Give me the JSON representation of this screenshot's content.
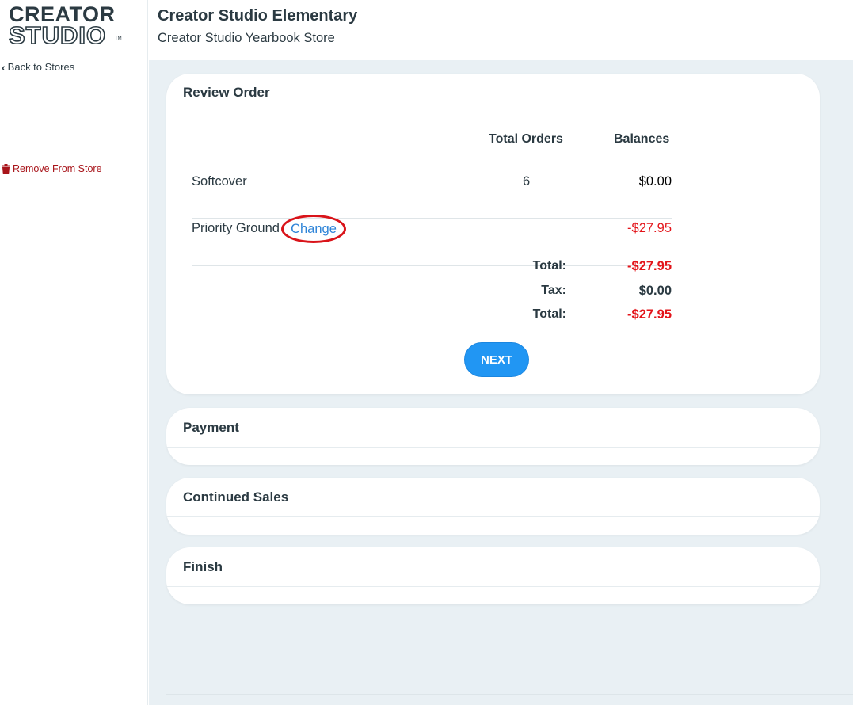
{
  "sidebar": {
    "logo": {
      "line1": "CREATOR",
      "line2": "STUDIO",
      "tm": "TM"
    },
    "back_label": "Back to Stores",
    "remove_label": "Remove From Store"
  },
  "header": {
    "title": "Creator Studio Elementary",
    "subtitle": "Creator Studio Yearbook Store"
  },
  "review": {
    "title": "Review Order",
    "columns": {
      "orders": "Total Orders",
      "balances": "Balances"
    },
    "items": [
      {
        "name": "Softcover",
        "orders": "6",
        "balance": "$0.00"
      },
      {
        "name": "Priority Ground",
        "action": "Change",
        "balance": "-$27.95"
      }
    ],
    "summary": [
      {
        "label": "Total:",
        "value": "-$27.95"
      },
      {
        "label": "Tax:",
        "value": "$0.00"
      },
      {
        "label": "Total:",
        "value": "-$27.95"
      }
    ],
    "next_label": "NEXT"
  },
  "sections": {
    "payment": "Payment",
    "continued_sales": "Continued Sales",
    "finish": "Finish"
  },
  "colors": {
    "primary": "#2196f3",
    "negative": "#e3141a",
    "danger": "#a8141a",
    "text": "#2b3a42",
    "background": "#e9f0f4"
  }
}
